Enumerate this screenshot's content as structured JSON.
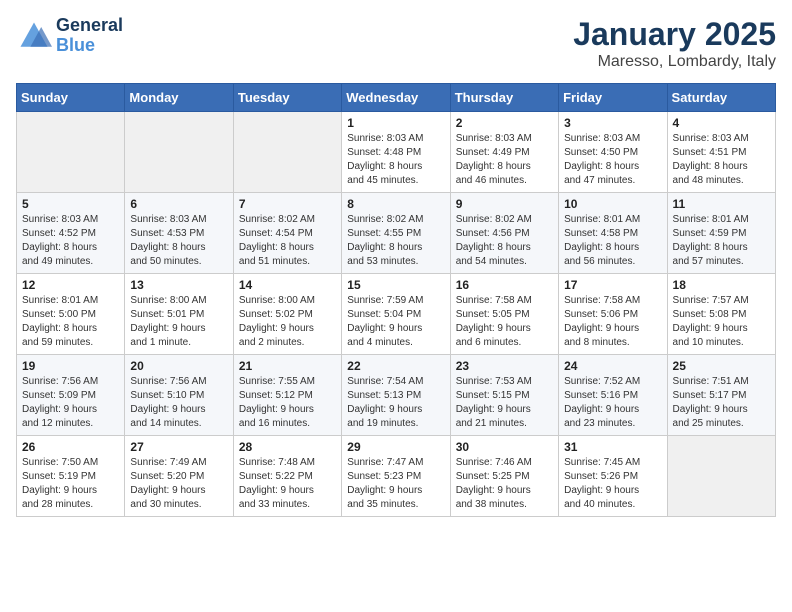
{
  "header": {
    "logo_line1": "General",
    "logo_line2": "Blue",
    "title": "January 2025",
    "subtitle": "Maresso, Lombardy, Italy"
  },
  "weekdays": [
    "Sunday",
    "Monday",
    "Tuesday",
    "Wednesday",
    "Thursday",
    "Friday",
    "Saturday"
  ],
  "weeks": [
    [
      {
        "day": "",
        "info": ""
      },
      {
        "day": "",
        "info": ""
      },
      {
        "day": "",
        "info": ""
      },
      {
        "day": "1",
        "info": "Sunrise: 8:03 AM\nSunset: 4:48 PM\nDaylight: 8 hours\nand 45 minutes."
      },
      {
        "day": "2",
        "info": "Sunrise: 8:03 AM\nSunset: 4:49 PM\nDaylight: 8 hours\nand 46 minutes."
      },
      {
        "day": "3",
        "info": "Sunrise: 8:03 AM\nSunset: 4:50 PM\nDaylight: 8 hours\nand 47 minutes."
      },
      {
        "day": "4",
        "info": "Sunrise: 8:03 AM\nSunset: 4:51 PM\nDaylight: 8 hours\nand 48 minutes."
      }
    ],
    [
      {
        "day": "5",
        "info": "Sunrise: 8:03 AM\nSunset: 4:52 PM\nDaylight: 8 hours\nand 49 minutes."
      },
      {
        "day": "6",
        "info": "Sunrise: 8:03 AM\nSunset: 4:53 PM\nDaylight: 8 hours\nand 50 minutes."
      },
      {
        "day": "7",
        "info": "Sunrise: 8:02 AM\nSunset: 4:54 PM\nDaylight: 8 hours\nand 51 minutes."
      },
      {
        "day": "8",
        "info": "Sunrise: 8:02 AM\nSunset: 4:55 PM\nDaylight: 8 hours\nand 53 minutes."
      },
      {
        "day": "9",
        "info": "Sunrise: 8:02 AM\nSunset: 4:56 PM\nDaylight: 8 hours\nand 54 minutes."
      },
      {
        "day": "10",
        "info": "Sunrise: 8:01 AM\nSunset: 4:58 PM\nDaylight: 8 hours\nand 56 minutes."
      },
      {
        "day": "11",
        "info": "Sunrise: 8:01 AM\nSunset: 4:59 PM\nDaylight: 8 hours\nand 57 minutes."
      }
    ],
    [
      {
        "day": "12",
        "info": "Sunrise: 8:01 AM\nSunset: 5:00 PM\nDaylight: 8 hours\nand 59 minutes."
      },
      {
        "day": "13",
        "info": "Sunrise: 8:00 AM\nSunset: 5:01 PM\nDaylight: 9 hours\nand 1 minute."
      },
      {
        "day": "14",
        "info": "Sunrise: 8:00 AM\nSunset: 5:02 PM\nDaylight: 9 hours\nand 2 minutes."
      },
      {
        "day": "15",
        "info": "Sunrise: 7:59 AM\nSunset: 5:04 PM\nDaylight: 9 hours\nand 4 minutes."
      },
      {
        "day": "16",
        "info": "Sunrise: 7:58 AM\nSunset: 5:05 PM\nDaylight: 9 hours\nand 6 minutes."
      },
      {
        "day": "17",
        "info": "Sunrise: 7:58 AM\nSunset: 5:06 PM\nDaylight: 9 hours\nand 8 minutes."
      },
      {
        "day": "18",
        "info": "Sunrise: 7:57 AM\nSunset: 5:08 PM\nDaylight: 9 hours\nand 10 minutes."
      }
    ],
    [
      {
        "day": "19",
        "info": "Sunrise: 7:56 AM\nSunset: 5:09 PM\nDaylight: 9 hours\nand 12 minutes."
      },
      {
        "day": "20",
        "info": "Sunrise: 7:56 AM\nSunset: 5:10 PM\nDaylight: 9 hours\nand 14 minutes."
      },
      {
        "day": "21",
        "info": "Sunrise: 7:55 AM\nSunset: 5:12 PM\nDaylight: 9 hours\nand 16 minutes."
      },
      {
        "day": "22",
        "info": "Sunrise: 7:54 AM\nSunset: 5:13 PM\nDaylight: 9 hours\nand 19 minutes."
      },
      {
        "day": "23",
        "info": "Sunrise: 7:53 AM\nSunset: 5:15 PM\nDaylight: 9 hours\nand 21 minutes."
      },
      {
        "day": "24",
        "info": "Sunrise: 7:52 AM\nSunset: 5:16 PM\nDaylight: 9 hours\nand 23 minutes."
      },
      {
        "day": "25",
        "info": "Sunrise: 7:51 AM\nSunset: 5:17 PM\nDaylight: 9 hours\nand 25 minutes."
      }
    ],
    [
      {
        "day": "26",
        "info": "Sunrise: 7:50 AM\nSunset: 5:19 PM\nDaylight: 9 hours\nand 28 minutes."
      },
      {
        "day": "27",
        "info": "Sunrise: 7:49 AM\nSunset: 5:20 PM\nDaylight: 9 hours\nand 30 minutes."
      },
      {
        "day": "28",
        "info": "Sunrise: 7:48 AM\nSunset: 5:22 PM\nDaylight: 9 hours\nand 33 minutes."
      },
      {
        "day": "29",
        "info": "Sunrise: 7:47 AM\nSunset: 5:23 PM\nDaylight: 9 hours\nand 35 minutes."
      },
      {
        "day": "30",
        "info": "Sunrise: 7:46 AM\nSunset: 5:25 PM\nDaylight: 9 hours\nand 38 minutes."
      },
      {
        "day": "31",
        "info": "Sunrise: 7:45 AM\nSunset: 5:26 PM\nDaylight: 9 hours\nand 40 minutes."
      },
      {
        "day": "",
        "info": ""
      }
    ]
  ]
}
